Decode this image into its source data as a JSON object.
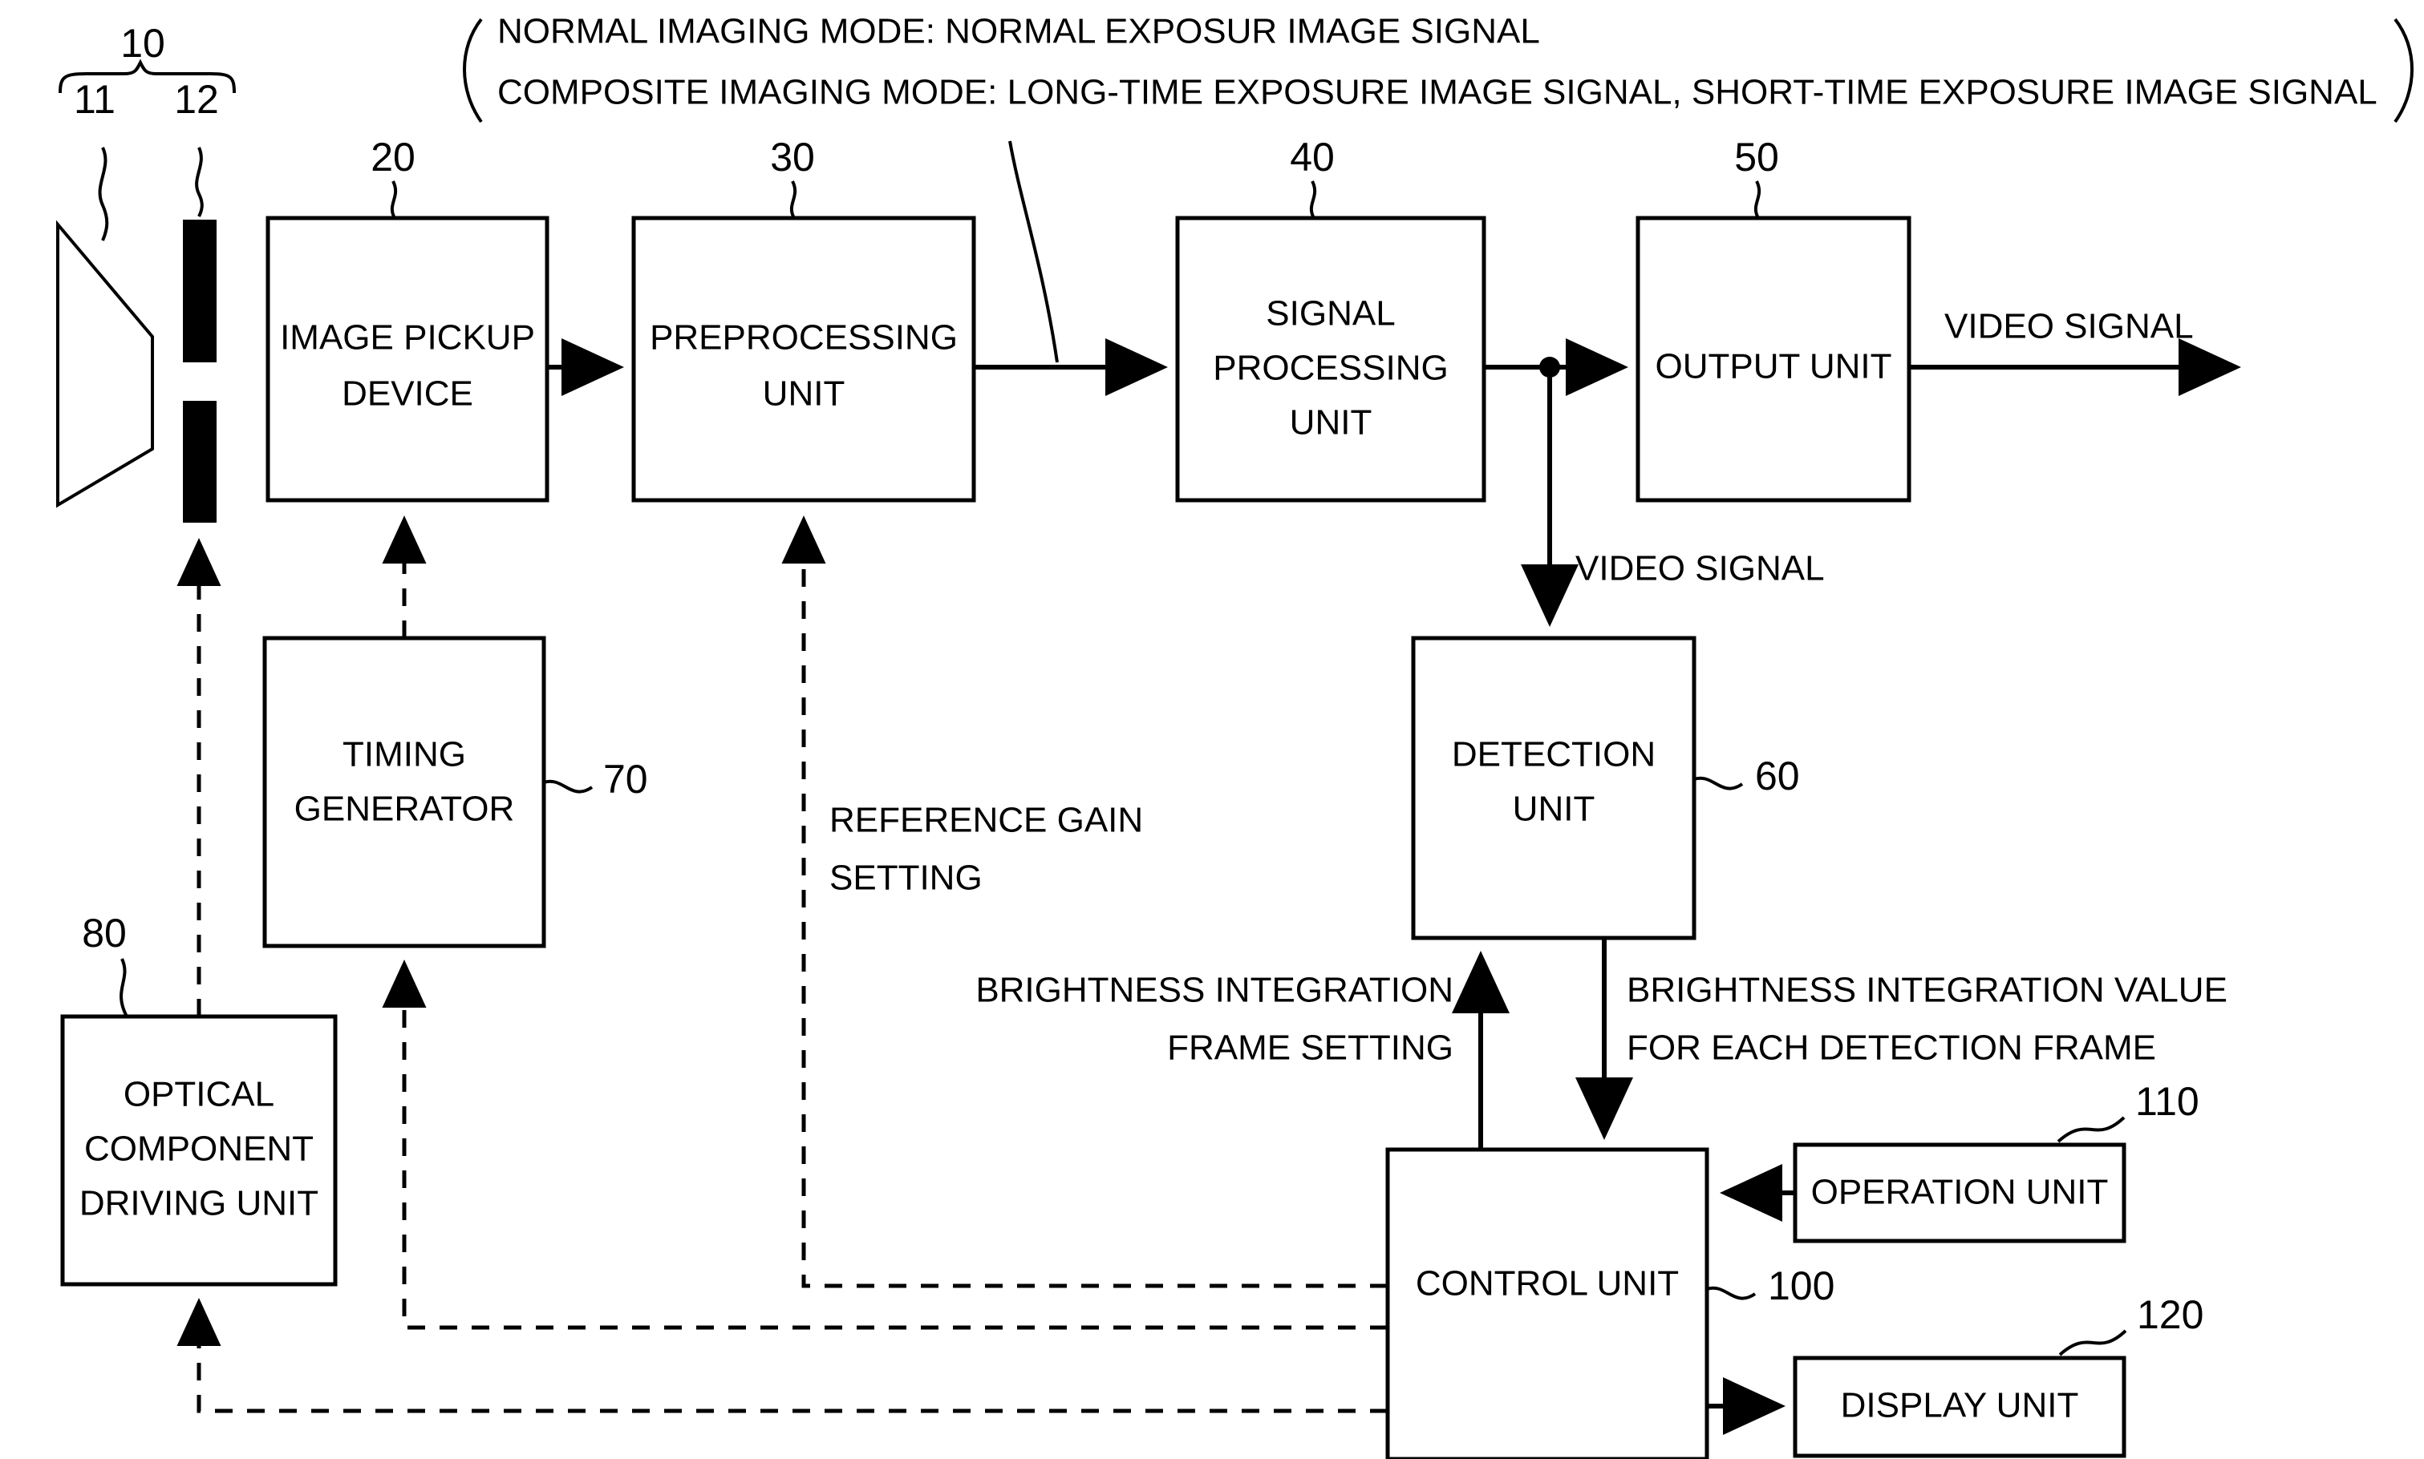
{
  "figure": {
    "type": "block-diagram",
    "title_annotation": {
      "line1": "NORMAL IMAGING MODE: NORMAL EXPOSUR IMAGE SIGNAL",
      "line2": "COMPOSITE IMAGING MODE: LONG-TIME EXPOSURE IMAGE SIGNAL, SHORT-TIME EXPOSURE IMAGE SIGNAL"
    },
    "blocks": [
      {
        "id": "image-pickup-device",
        "ref": "20",
        "line1": "IMAGE PICKUP",
        "line2": "DEVICE"
      },
      {
        "id": "preprocessing-unit",
        "ref": "30",
        "line1": "PREPROCESSING",
        "line2": "UNIT"
      },
      {
        "id": "signal-processing-unit",
        "ref": "40",
        "line1": "SIGNAL",
        "line2": "PROCESSING",
        "line3": "UNIT"
      },
      {
        "id": "output-unit",
        "ref": "50",
        "line1": "OUTPUT UNIT"
      },
      {
        "id": "detection-unit",
        "ref": "60",
        "line1": "DETECTION",
        "line2": "UNIT"
      },
      {
        "id": "timing-generator",
        "ref": "70",
        "line1": "TIMING",
        "line2": "GENERATOR"
      },
      {
        "id": "optical-component-driving-unit",
        "ref": "80",
        "line1": "OPTICAL",
        "line2": "COMPONENT",
        "line3": "DRIVING UNIT"
      },
      {
        "id": "control-unit",
        "ref": "100",
        "line1": "CONTROL UNIT"
      },
      {
        "id": "operation-unit",
        "ref": "110",
        "line1": "OPERATION UNIT"
      },
      {
        "id": "display-unit",
        "ref": "120",
        "line1": "DISPLAY UNIT"
      }
    ],
    "optics": {
      "group_ref": "10",
      "lens_ref": "11",
      "iris_ref": "12"
    },
    "signal_labels": {
      "video_signal_out": "VIDEO SIGNAL",
      "video_signal_detect": "VIDEO SIGNAL",
      "reference_gain_setting_l1": "REFERENCE GAIN",
      "reference_gain_setting_l2": "SETTING",
      "brightness_integration_frame_setting_l1": "BRIGHTNESS INTEGRATION",
      "brightness_integration_frame_setting_l2": "FRAME SETTING",
      "brightness_integration_value_l1": "BRIGHTNESS INTEGRATION VALUE",
      "brightness_integration_value_l2": "FOR EACH DETECTION FRAME"
    },
    "colors": {
      "ink": "#000000",
      "paper": "#ffffff"
    }
  }
}
